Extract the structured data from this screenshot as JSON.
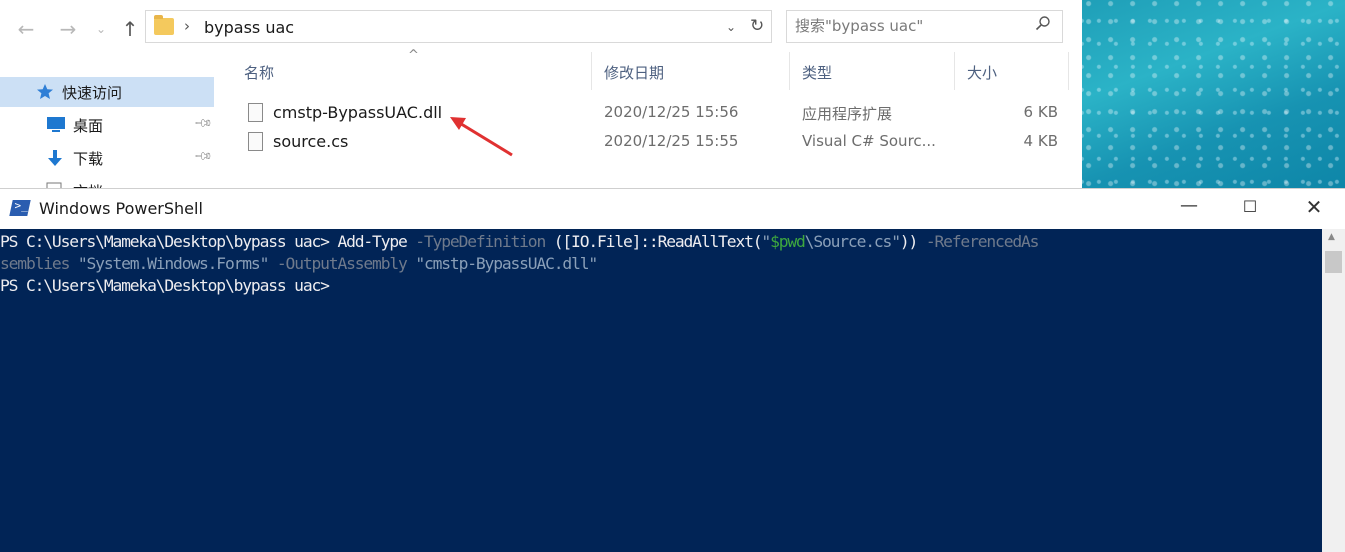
{
  "explorer": {
    "nav": {
      "back": "←",
      "forward": "→",
      "recent": "⌄",
      "up": "↑"
    },
    "address": {
      "separator": "›",
      "path": "bypass uac",
      "dropdown": "⌄",
      "refresh": "↻"
    },
    "search": {
      "placeholder": "搜索\"bypass uac\"",
      "icon": "search-icon"
    },
    "sidebar": {
      "items": [
        {
          "label": "快速访问",
          "icon": "star-icon"
        },
        {
          "label": "桌面",
          "icon": "desktop-icon"
        },
        {
          "label": "下载",
          "icon": "download-icon"
        },
        {
          "label": "文档",
          "icon": "document-icon"
        }
      ]
    },
    "columns": {
      "name": "名称",
      "modified": "修改日期",
      "type": "类型",
      "size": "大小",
      "sort_indicator": "^"
    },
    "files": [
      {
        "name": "cmstp-BypassUAC.dll",
        "modified": "2020/12/25 15:56",
        "type": "应用程序扩展",
        "size": "6 KB"
      },
      {
        "name": "source.cs",
        "modified": "2020/12/25 15:55",
        "type": "Visual C# Sourc...",
        "size": "4 KB"
      }
    ],
    "annotation_color": "#e03131"
  },
  "powershell": {
    "title": "Windows PowerShell",
    "controls": {
      "minimize": "—",
      "maximize": "☐",
      "close": "✕"
    },
    "console": {
      "line1": {
        "prompt": "PS C:\\Users\\Mameka\\Desktop\\bypass uac> ",
        "cmd": "Add-Type",
        "p1": " -TypeDefinition ",
        "t1": "([IO.File]::ReadAllText(",
        "q1": "\"",
        "var": "$pwd",
        "s1": "\\Source.cs",
        "q2": "\"",
        "t2": ")) ",
        "p2": "-ReferencedAs"
      },
      "line2": {
        "p0": "semblies ",
        "s2": "\"System.Windows.Forms\"",
        "p3": " -OutputAssembly ",
        "s3": "\"cmstp-BypassUAC.dll\""
      },
      "line3": {
        "prompt": "PS C:\\Users\\Mameka\\Desktop\\bypass uac>"
      }
    },
    "background_color": "#012456"
  }
}
